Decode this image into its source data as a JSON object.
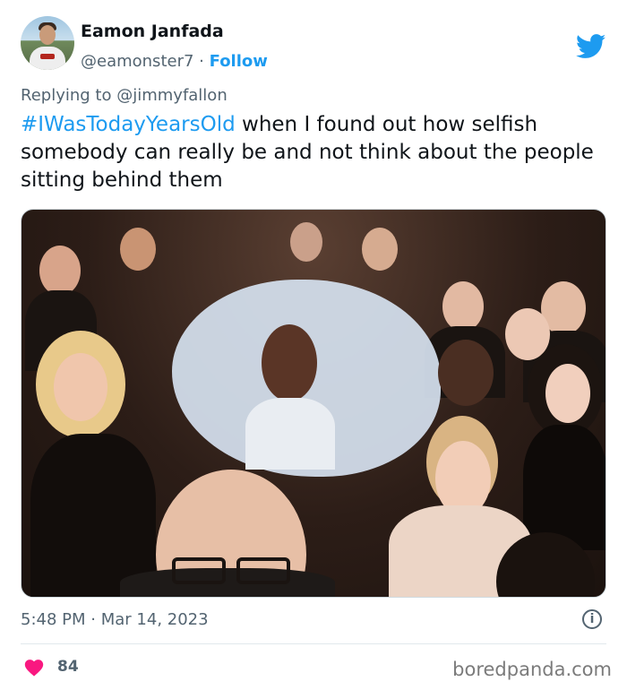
{
  "tweet": {
    "author_name": "Eamon Janfada",
    "author_handle": "@eamonster7",
    "separator": "·",
    "follow_label": "Follow",
    "replying_prefix": "Replying to",
    "replying_to": "@jimmyfallon",
    "hashtag": "#IWasTodayYearsOld",
    "body": " when I found out how selfish somebody can really be and not think about the people sitting behind them",
    "time": "5:48 PM",
    "date_separator": "·",
    "date": "Mar 14, 2023",
    "like_count": "84"
  },
  "icons": {
    "brand": "twitter-bird-icon",
    "info": "info-icon",
    "like": "heart-icon"
  },
  "colors": {
    "accent": "#1d9bf0",
    "muted": "#536471",
    "heart": "#f91880"
  },
  "watermark": "boredpanda.com"
}
